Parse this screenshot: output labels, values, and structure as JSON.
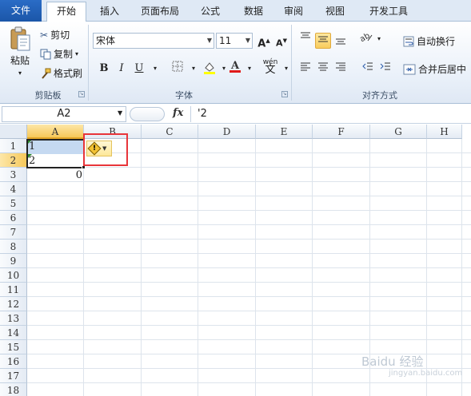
{
  "tabs": {
    "file": "文件",
    "home": "开始",
    "insert": "插入",
    "layout": "页面布局",
    "formulas": "公式",
    "data": "数据",
    "review": "审阅",
    "view": "视图",
    "developer": "开发工具"
  },
  "clipboard": {
    "paste": "粘贴",
    "cut": "剪切",
    "copy": "复制",
    "format_painter": "格式刷",
    "group_label": "剪贴板"
  },
  "font": {
    "name": "宋体",
    "size": "11",
    "bold": "B",
    "italic": "I",
    "underline": "U",
    "group_label": "字体"
  },
  "alignment": {
    "wrap_text": "自动换行",
    "merge_center": "合并后居中",
    "group_label": "对齐方式"
  },
  "formula_bar": {
    "name_box": "A2",
    "fx": "fx",
    "content": "'2"
  },
  "columns": [
    "A",
    "B",
    "C",
    "D",
    "E",
    "F",
    "G",
    "H"
  ],
  "rows": [
    "1",
    "2",
    "3",
    "4",
    "5",
    "6",
    "7",
    "8",
    "9",
    "10",
    "11",
    "12",
    "13",
    "14",
    "15",
    "16",
    "17",
    "18"
  ],
  "cells": {
    "A1": "1",
    "A2": "2",
    "A3": "0"
  },
  "selected_cell": "A2",
  "watermark": {
    "brand": "Baidu 经验",
    "url": "jingyan.baidu.com"
  },
  "colors": {
    "file_tab": "#2a6cc6",
    "selection_fill": "#c5d9f1",
    "header_selected": "#f6c85a",
    "error_indicator": "#2c8a2c",
    "highlight_box": "#e8353a"
  }
}
